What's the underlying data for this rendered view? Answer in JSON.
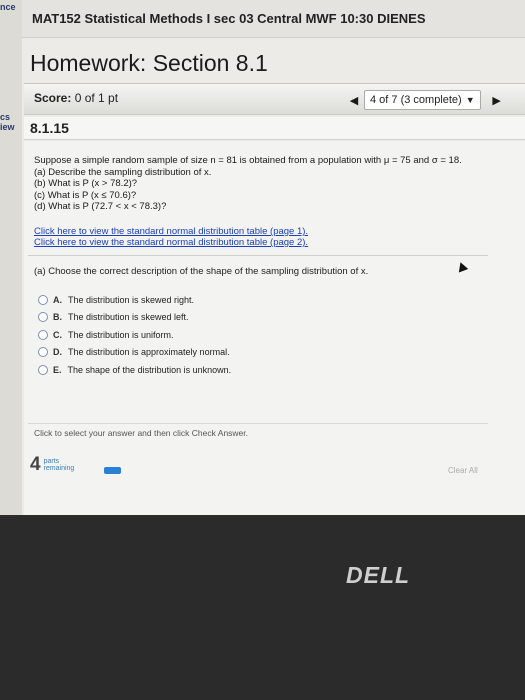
{
  "left_strip": {
    "frag_top": "nce",
    "frag_mid1": "cs",
    "frag_mid2": "iew"
  },
  "course": {
    "title": "MAT152 Statistical Methods I sec 03 Central MWF 10:30 DIENES"
  },
  "homework": {
    "title": "Homework: Section 8.1"
  },
  "score": {
    "label": "Score:",
    "value": "0 of 1 pt"
  },
  "nav": {
    "prev_icon": "triangle-left-icon",
    "next_icon": "triangle-right-icon",
    "selected": "4 of 7 (3 complete)"
  },
  "question": {
    "number": "8.1.15",
    "prompt_pre": "Suppose a simple random sample of size n = 81 is obtained from a population with μ = 75 and σ = 18.",
    "part_a": "(a) Describe the sampling distribution of x.",
    "part_b": "(b) What is P (x > 78.2)?",
    "part_c": "(c) What is P (x ≤ 70.6)?",
    "part_d": "(d) What is P (72.7 < x < 78.3)?"
  },
  "links": {
    "page1": "Click here to view the standard normal distribution table (page 1).",
    "page2": "Click here to view the standard normal distribution table (page 2)."
  },
  "part_a_prompt": "(a) Choose the correct description of the shape of the sampling distribution of x.",
  "options": [
    {
      "letter": "A.",
      "text": "The distribution is skewed right."
    },
    {
      "letter": "B.",
      "text": "The distribution is skewed left."
    },
    {
      "letter": "C.",
      "text": "The distribution is uniform."
    },
    {
      "letter": "D.",
      "text": "The distribution is approximately normal."
    },
    {
      "letter": "E.",
      "text": "The shape of the distribution is unknown."
    }
  ],
  "footer": {
    "instructions": "Click to select your answer and then click Check Answer.",
    "parts_count": "4",
    "parts_line1": "parts",
    "parts_line2": "remaining",
    "progress": 0.25,
    "clear_all": "Clear All"
  },
  "bezel": {
    "logo": "DELL"
  },
  "colors": {
    "link": "#1a3fbf",
    "progress": "#2b7fd5",
    "radio_border": "#7a8fb5"
  }
}
